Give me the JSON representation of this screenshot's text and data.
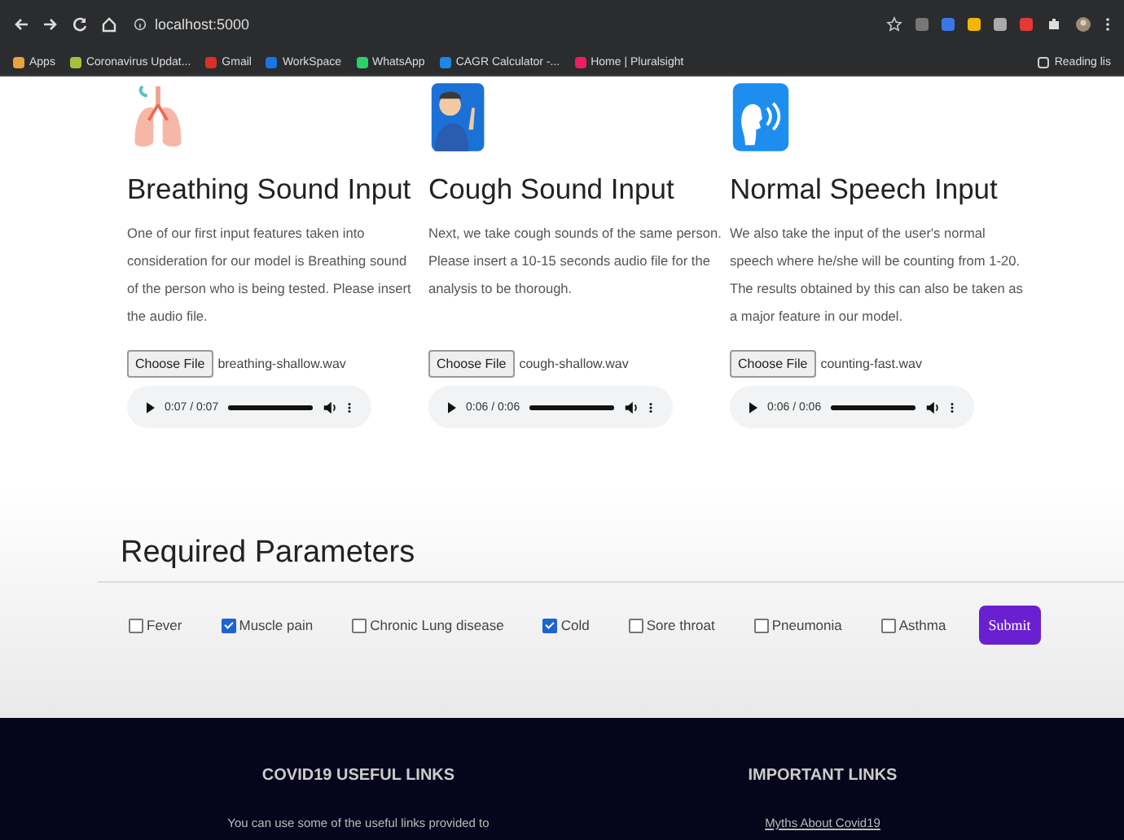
{
  "browser": {
    "url": "localhost:5000",
    "bookmarks": [
      {
        "label": "Apps"
      },
      {
        "label": "Coronavirus Updat..."
      },
      {
        "label": "Gmail"
      },
      {
        "label": "WorkSpace"
      },
      {
        "label": "WhatsApp"
      },
      {
        "label": "CAGR Calculator -..."
      },
      {
        "label": "Home | Pluralsight"
      }
    ],
    "reading_list": "Reading lis"
  },
  "inputs": [
    {
      "title": "Breathing Sound Input",
      "description": "One of our first input features taken into consideration for our model is Breathing sound of the person who is being tested. Please insert the audio file.",
      "file_button": "Choose File",
      "file_name": "breathing-shallow.wav",
      "player": {
        "time": "0:07 / 0:07",
        "level": 1
      }
    },
    {
      "title": "Cough Sound Input",
      "description": "Next, we take cough sounds of the same person. Please insert a 10-15 seconds audio file for the analysis to be thorough.",
      "file_button": "Choose File",
      "file_name": "cough-shallow.wav",
      "player": {
        "time": "0:06 / 0:06",
        "level": 1
      }
    },
    {
      "title": "Normal Speech Input",
      "description": "We also take the input of the user's normal speech where he/she will be counting from 1-20. The results obtained by this can also be taken as a major feature in our model.",
      "file_button": "Choose File",
      "file_name": "counting-fast.wav",
      "player": {
        "time": "0:06 / 0:06",
        "level": 1
      }
    }
  ],
  "parameters": {
    "title": "Required Parameters",
    "options": [
      {
        "label": "Fever",
        "checked": false
      },
      {
        "label": "Muscle pain",
        "checked": true
      },
      {
        "label": "Chronic Lung disease",
        "checked": false
      },
      {
        "label": "Cold",
        "checked": true
      },
      {
        "label": "Sore throat",
        "checked": false
      },
      {
        "label": "Pneumonia",
        "checked": false
      },
      {
        "label": "Asthma",
        "checked": false
      }
    ],
    "submit": "Submit"
  },
  "footer": {
    "columns": [
      {
        "heading": "COVID19 USEFUL LINKS",
        "text": "You can use some of the useful links provided to",
        "kind": "text"
      },
      {
        "heading": "IMPORTANT LINKS",
        "text": "Myths About Covid19",
        "kind": "link"
      }
    ]
  }
}
